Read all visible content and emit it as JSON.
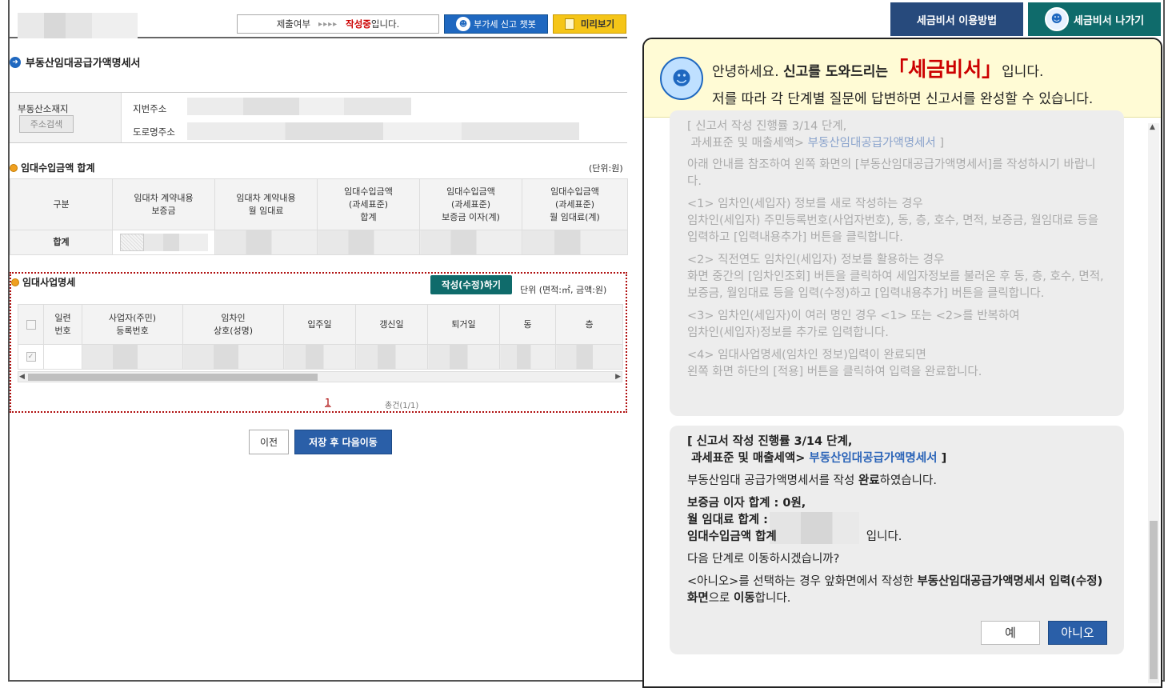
{
  "top_bar": {
    "submit_label": "제출여부",
    "submit_arrows": "▸▸▸▸",
    "submit_status_red": "작성중",
    "submit_status_suffix": "입니다.",
    "vat_chatbot_btn": "부가세 신고 챗봇",
    "preview_btn": "미리보기"
  },
  "section_title": "부동산임대공급가액명세서",
  "address": {
    "label": "부동산소재지",
    "search_btn": "주소검색",
    "lot_label": "지번주소",
    "road_label": "도로명주소"
  },
  "summary": {
    "title": "임대수입금액 합계",
    "unit": "(단위:원)",
    "headers": [
      "구분",
      "임대차 계약내용\n보증금",
      "임대차 계약내용\n월 임대료",
      "임대수입금액\n(과세표준)\n합계",
      "임대수입금액\n(과세표준)\n보증금 이자(계)",
      "임대수입금액\n(과세표준)\n월 임대료(계)"
    ],
    "row_label": "합계"
  },
  "detail": {
    "title": "임대사업명세",
    "write_btn": "작성(수정)하기",
    "unit": "단위 (면적:㎡, 금액:원)",
    "headers": [
      "",
      "일련\n번호",
      "사업자(주민)\n등록번호",
      "임차인\n상호(성명)",
      "입주일",
      "갱신일",
      "퇴거일",
      "동",
      "층"
    ],
    "page_number": "1",
    "count": "총건(1/1)"
  },
  "nav": {
    "prev_btn": "이전",
    "next_btn": "저장 후 다음이동"
  },
  "chat_header": {
    "howto_btn": "세금비서 이용방법",
    "exit_btn": "세금비서 나가기",
    "greet_pre": "안녕하세요. ",
    "greet_bold": "신고를 도와드리는",
    "greet_brand": "「세금비서」",
    "greet_post": "입니다.",
    "greet_line2": "저를 따라 각 단계별 질문에 답변하면 신고서를 완성할 수 있습니다."
  },
  "chat_old": {
    "progress_1": "[ 신고서 작성 진행률 3/14 단계,",
    "progress_2": "과세표준 및 매출세액> ",
    "progress_link": "부동산임대공급가액명세서",
    "progress_end": " ]",
    "intro": "아래 안내를 참조하여 왼쪽 화면의 [부동산임대공급가액명세서]를 작성하시기 바랍니다.",
    "s1_title": "<1> 임차인(세입자) 정보를 새로 작성하는 경우",
    "s1_body": "임차인(세입자) 주민등록번호(사업자번호), 동, 층, 호수, 면적, 보증금, 월임대료 등을 입력하고 [입력내용추가] 버튼을 클릭합니다.",
    "s2_title": "<2> 직전연도 임차인(세입자) 정보를 활용하는 경우",
    "s2_body": "화면 중간의 [임차인조회] 버튼을 클릭하여 세입자정보를 불러온 후 동, 층, 호수, 면적, 보증금, 월임대료 등을 입력(수정)하고 [입력내용추가] 버튼을 클릭합니다.",
    "s3_title": "<3> 임차인(세입자)이 여러 명인 경우 <1> 또는 <2>를 반복하여",
    "s3_body": "임차인(세입자)정보를 추가로 입력합니다.",
    "s4_title": "<4> 임대사업명세(임차인 정보)입력이 완료되면",
    "s4_body": "왼쪽 화면 하단의 [적용] 버튼을 클릭하여 입력을 완료합니다."
  },
  "chat_new": {
    "progress_1": "[ 신고서 작성 진행률 3/14 단계,",
    "progress_2": "과세표준 및 매출세액> ",
    "progress_link": "부동산임대공급가액명세서",
    "progress_end": " ]",
    "done_pre": "부동산임대 공급가액명세서를 작성 ",
    "done_bold": "완료",
    "done_post": "하였습니다.",
    "deposit_interest": "보증금 이자 합계 : 0원,",
    "monthly_rent": "월 임대료 합계 :",
    "rental_income": "임대수입금액 합계",
    "rental_income_suffix": "입니다.",
    "question": "다음 단계로 이동하시겠습니까?",
    "no_note_pre": "<아니오>를 선택하는 경우 앞화면에서 작성한 ",
    "no_note_bold": "부동산임대공급가액명세서 입력(수정)화면",
    "no_note_mid": "으로 ",
    "no_note_bold2": "이동",
    "no_note_post": "합니다.",
    "yes_btn": "예",
    "no_btn": "아니오"
  }
}
